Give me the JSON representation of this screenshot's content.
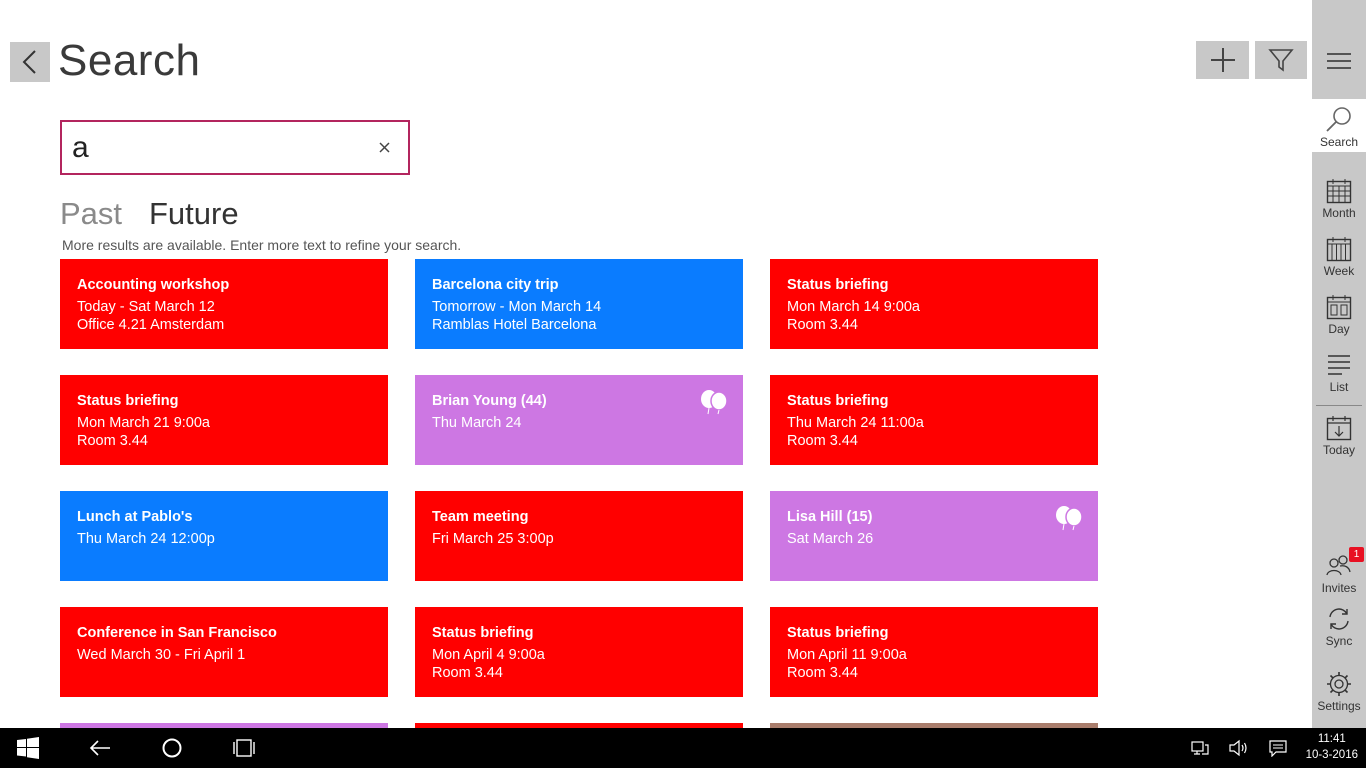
{
  "header": {
    "title": "Search"
  },
  "search": {
    "value": "a"
  },
  "tabs": {
    "past": "Past",
    "future": "Future"
  },
  "hint": "More results are available. Enter more text to refine your search.",
  "colors": {
    "red": "#ff0000",
    "blue": "#0a7cff",
    "purple": "#cd77e3",
    "brown": "#a97d6c",
    "accent": "#b3255e"
  },
  "events": [
    {
      "title": "Accounting workshop",
      "line1": "Today - Sat March 12",
      "line2": "Office 4.21 Amsterdam"
    },
    {
      "title": "Barcelona city trip",
      "line1": "Tomorrow - Mon March 14",
      "line2": "Ramblas Hotel Barcelona"
    },
    {
      "title": "Status briefing",
      "line1": "Mon March 14 9:00a",
      "line2": "Room 3.44"
    },
    {
      "title": "Status briefing",
      "line1": "Mon March 21 9:00a",
      "line2": "Room 3.44"
    },
    {
      "title": "Brian Young (44)",
      "line1": "Thu March 24",
      "line2": "",
      "icon": "balloons-icon"
    },
    {
      "title": "Status briefing",
      "line1": "Thu March 24 11:00a",
      "line2": "Room 3.44"
    },
    {
      "title": "Lunch at Pablo's",
      "line1": "Thu March 24 12:00p",
      "line2": ""
    },
    {
      "title": "Team meeting",
      "line1": "Fri March 25 3:00p",
      "line2": ""
    },
    {
      "title": "Lisa Hill (15)",
      "line1": "Sat March 26",
      "line2": "",
      "icon": "balloons-icon"
    },
    {
      "title": "Conference in San Francisco",
      "line1": "Wed March 30 - Fri April 1",
      "line2": ""
    },
    {
      "title": "Status briefing",
      "line1": "Mon April 4 9:00a",
      "line2": "Room 3.44"
    },
    {
      "title": "Status briefing",
      "line1": "Mon April 11 9:00a",
      "line2": "Room 3.44"
    }
  ],
  "sidebar": {
    "search": "Search",
    "month": "Month",
    "week": "Week",
    "day": "Day",
    "list": "List",
    "today": "Today",
    "invites": "Invites",
    "invites_badge": "1",
    "sync": "Sync",
    "settings": "Settings"
  },
  "taskbar": {
    "time": "11:41",
    "date": "10-3-2016"
  }
}
